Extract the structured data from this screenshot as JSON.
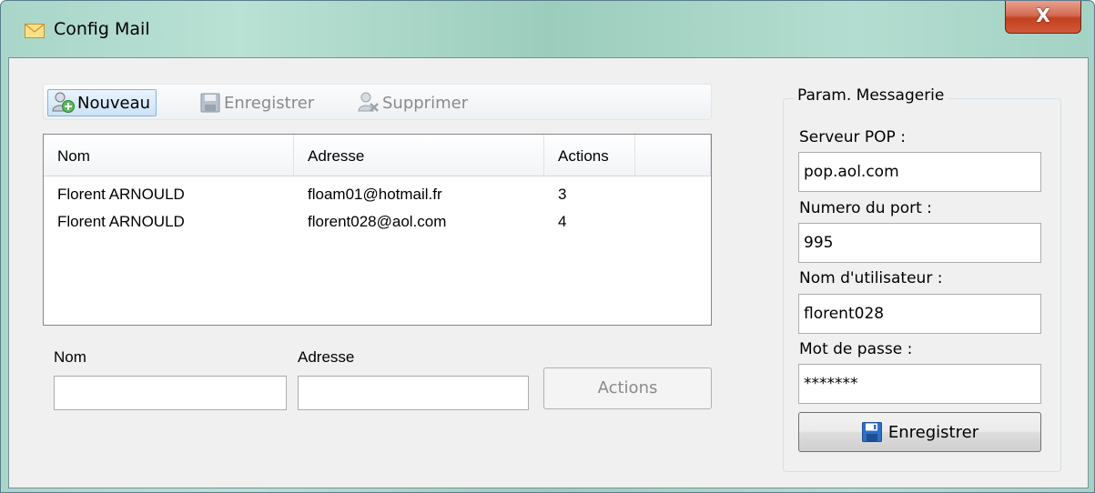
{
  "window": {
    "title": "Config Mail",
    "close_glyph": "X",
    "title_icon": "envelope-icon",
    "close_icon": "close-icon"
  },
  "toolbar": {
    "new_label": "Nouveau",
    "save_label": "Enregistrer",
    "delete_label": "Supprimer",
    "new_icon": "add-user-icon",
    "save_icon": "floppy-disk-icon",
    "delete_icon": "remove-user-icon"
  },
  "list": {
    "columns": [
      "Nom",
      "Adresse",
      "Actions",
      ""
    ],
    "rows": [
      {
        "nom": "Florent ARNOULD",
        "adresse": "floam01@hotmail.fr",
        "actions": "3"
      },
      {
        "nom": "Florent ARNOULD",
        "adresse": "florent028@aol.com",
        "actions": "4"
      }
    ]
  },
  "form": {
    "nom_label": "Nom",
    "adresse_label": "Adresse",
    "nom_value": "",
    "adresse_value": "",
    "actions_button": "Actions"
  },
  "settings": {
    "group_title": "Param. Messagerie",
    "pop_label": "Serveur POP :",
    "pop_value": "pop.aol.com",
    "port_label": "Numero du port :",
    "port_value": "995",
    "user_label": "Nom d'utilisateur :",
    "user_value": "florent028",
    "password_label": "Mot de passe :",
    "password_value": "*******",
    "save_button": "Enregistrer"
  },
  "colors": {
    "title_bar": "#a9d6c9",
    "close_button": "#c94a2c",
    "selection": "#cde3f7",
    "disabled_text": "#8a8a8a"
  }
}
